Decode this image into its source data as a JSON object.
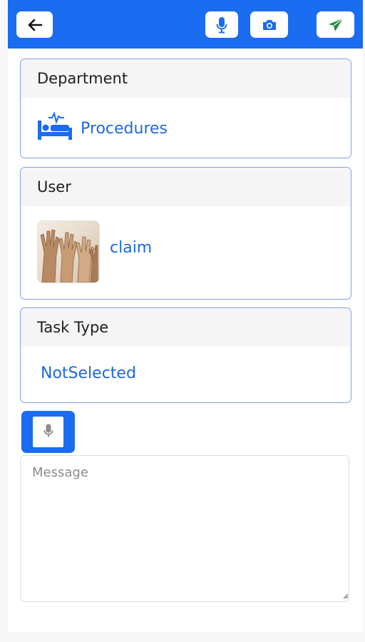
{
  "header": {
    "back_icon": "arrow-left-icon",
    "voice_icon": "microphone-icon",
    "camera_icon": "camera-icon",
    "send_icon": "paper-plane-icon",
    "bar_color": "#1a6cf0",
    "send_color": "#1f8a3c"
  },
  "department": {
    "heading": "Department",
    "icon": "hospital-bed-icon",
    "value": "Procedures"
  },
  "user": {
    "heading": "User",
    "avatar": "raised-hands-photo",
    "value": "claim"
  },
  "task_type": {
    "heading": "Task Type",
    "value": "NotSelected"
  },
  "voice_input": {
    "icon": "microphone-icon"
  },
  "message": {
    "placeholder": "Message",
    "value": ""
  }
}
